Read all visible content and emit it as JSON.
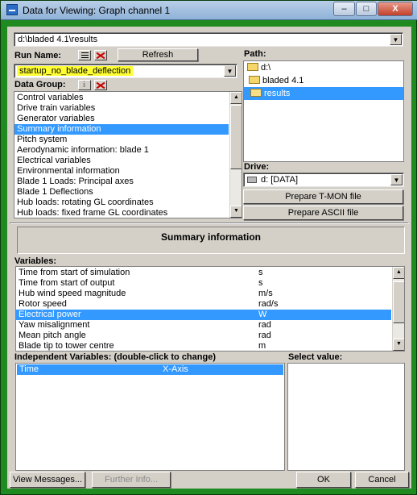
{
  "window": {
    "title": "Data for Viewing: Graph channel 1",
    "minimize": "–",
    "maximize": "□",
    "close": "X"
  },
  "path_combo": {
    "value": "d:\\bladed 4.1\\results"
  },
  "run_name": {
    "label": "Run Name:",
    "refresh": "Refresh",
    "value": "startup_no_blade_deflection"
  },
  "path": {
    "label": "Path:",
    "items": [
      {
        "label": "d:\\"
      },
      {
        "label": "bladed 4.1"
      },
      {
        "label": "results"
      }
    ]
  },
  "data_group": {
    "label": "Data Group:",
    "items": [
      "Control variables",
      "Drive train variables",
      "Generator variables",
      "Summary information",
      "Pitch system",
      "Aerodynamic information: blade 1",
      "Electrical variables",
      "Environmental information",
      "Blade 1 Loads: Principal axes",
      "Blade 1 Deflections",
      "Hub loads: rotating GL coordinates",
      "Hub loads: fixed frame GL coordinates"
    ],
    "selected_index": 3
  },
  "drive": {
    "label": "Drive:",
    "value": "d: [DATA]"
  },
  "buttons": {
    "tmon": "Prepare T-MON file",
    "ascii": "Prepare ASCII file",
    "view_messages": "View Messages...",
    "further_info": "Further Info...",
    "ok": "OK",
    "cancel": "Cancel"
  },
  "group_title": "Summary information",
  "variables": {
    "label": "Variables:",
    "rows": [
      {
        "name": "Time from start of simulation",
        "unit": "s"
      },
      {
        "name": "Time from start of output",
        "unit": "s"
      },
      {
        "name": "Hub wind speed magnitude",
        "unit": "m/s"
      },
      {
        "name": "Rotor speed",
        "unit": "rad/s"
      },
      {
        "name": "Electrical power",
        "unit": "W"
      },
      {
        "name": "Yaw misalignment",
        "unit": "rad"
      },
      {
        "name": "Mean pitch angle",
        "unit": "rad"
      },
      {
        "name": "Blade tip to tower centre",
        "unit": "m"
      }
    ],
    "selected_index": 4
  },
  "independent": {
    "label": "Independent Variables: (double-click to change)",
    "rows": [
      {
        "name": "Time",
        "axis": "X-Axis"
      }
    ]
  },
  "select_value": {
    "label": "Select value:"
  },
  "colors": {
    "selection": "#3399ff",
    "highlight": "#ffff33",
    "frame": "#1f8a1f",
    "face": "#d4d0c8"
  }
}
